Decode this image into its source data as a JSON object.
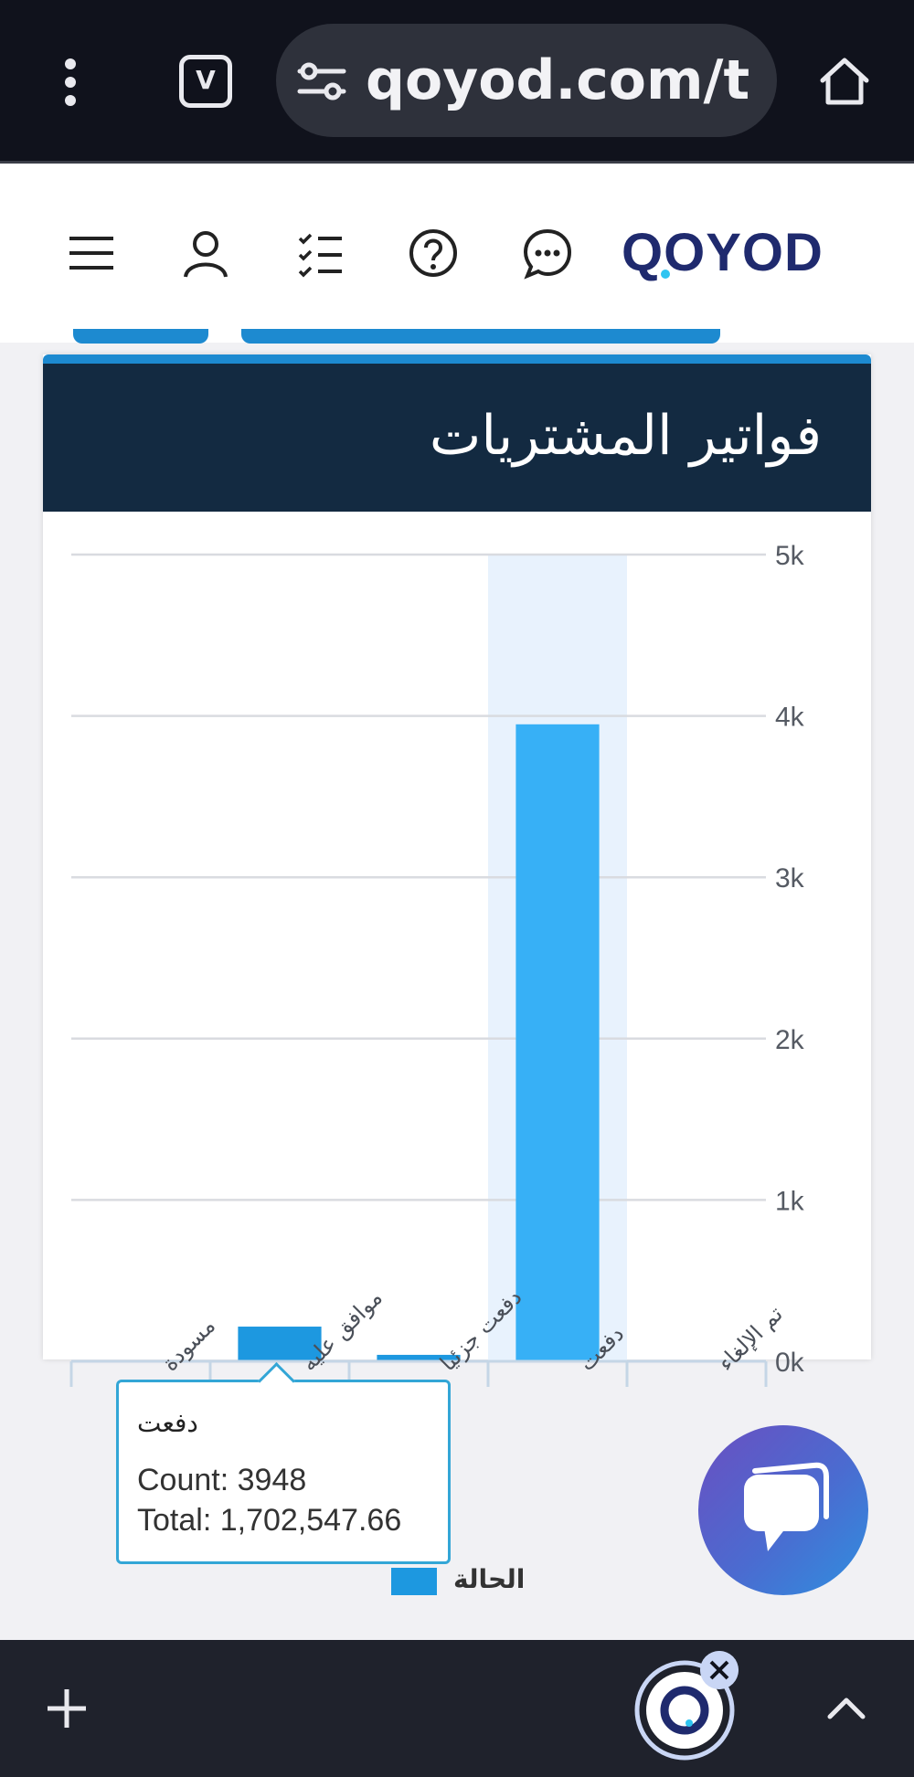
{
  "browser": {
    "url_text": "qoyod.com/t",
    "tabs_count": "V"
  },
  "header": {
    "logo_text": "QOYOD"
  },
  "card": {
    "title": "فواتير المشتريات"
  },
  "chart_data": {
    "type": "bar",
    "categories": [
      "تم الإلغاء",
      "دفعت",
      "دفعت جزئيا",
      "موافق عليه",
      "مسودة"
    ],
    "values": [
      0,
      3948,
      40,
      215,
      0
    ],
    "y_ticks": [
      "0k",
      "1k",
      "2k",
      "3k",
      "4k",
      "5k"
    ],
    "ylim": [
      0,
      5000
    ],
    "highlighted_category": "دفعت",
    "legend": [
      "الحالة"
    ],
    "grid": true,
    "bar_color": "#1d98e0",
    "highlight_bar_color": "#37b0f6"
  },
  "tooltip": {
    "title": "دفعت",
    "count_line": "Count: 3948",
    "total_line": "Total: 1,702,547.66"
  },
  "legend": {
    "label": "الحالة"
  },
  "colors": {
    "browser_bg": "#10121c",
    "card_header": "#132a41",
    "accent": "#1d8ad0",
    "logo": "#1f2a6e"
  }
}
